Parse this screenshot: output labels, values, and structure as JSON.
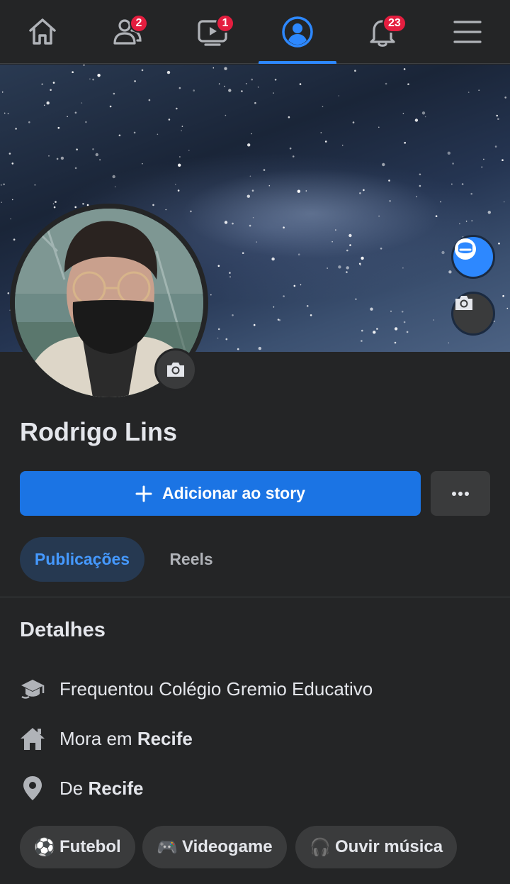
{
  "nav": {
    "items": [
      {
        "name": "home",
        "badge": ""
      },
      {
        "name": "friends",
        "badge": "2"
      },
      {
        "name": "watch",
        "badge": "1"
      },
      {
        "name": "profile",
        "badge": ""
      },
      {
        "name": "notifications",
        "badge": "23"
      },
      {
        "name": "menu",
        "badge": ""
      }
    ],
    "active_color": "#2d88ff",
    "badge_color": "#e41e3f"
  },
  "profile": {
    "name": "Rodrigo Lins"
  },
  "actions": {
    "story_label": "Adicionar ao story",
    "story_icon": "plus-icon",
    "more_icon": "ellipsis-icon",
    "primary_color": "#1b74e4"
  },
  "tabs": [
    {
      "label": "Publicações",
      "active": true
    },
    {
      "label": "Reels",
      "active": false
    }
  ],
  "details": {
    "title": "Detalhes",
    "rows": [
      {
        "icon": "graduation-cap-icon",
        "text": "Frequentou Colégio Gremio Educativo",
        "prefix": "",
        "bold": ""
      },
      {
        "icon": "home-icon",
        "text": "",
        "prefix": "Mora em ",
        "bold": "Recife"
      },
      {
        "icon": "location-pin-icon",
        "text": "",
        "prefix": "De ",
        "bold": "Recife"
      }
    ]
  },
  "hobbies": [
    {
      "emoji": "⚽",
      "label": "Futebol"
    },
    {
      "emoji": "🎮",
      "label": "Videogame"
    },
    {
      "emoji": "🎧",
      "label": "Ouvir música"
    }
  ]
}
